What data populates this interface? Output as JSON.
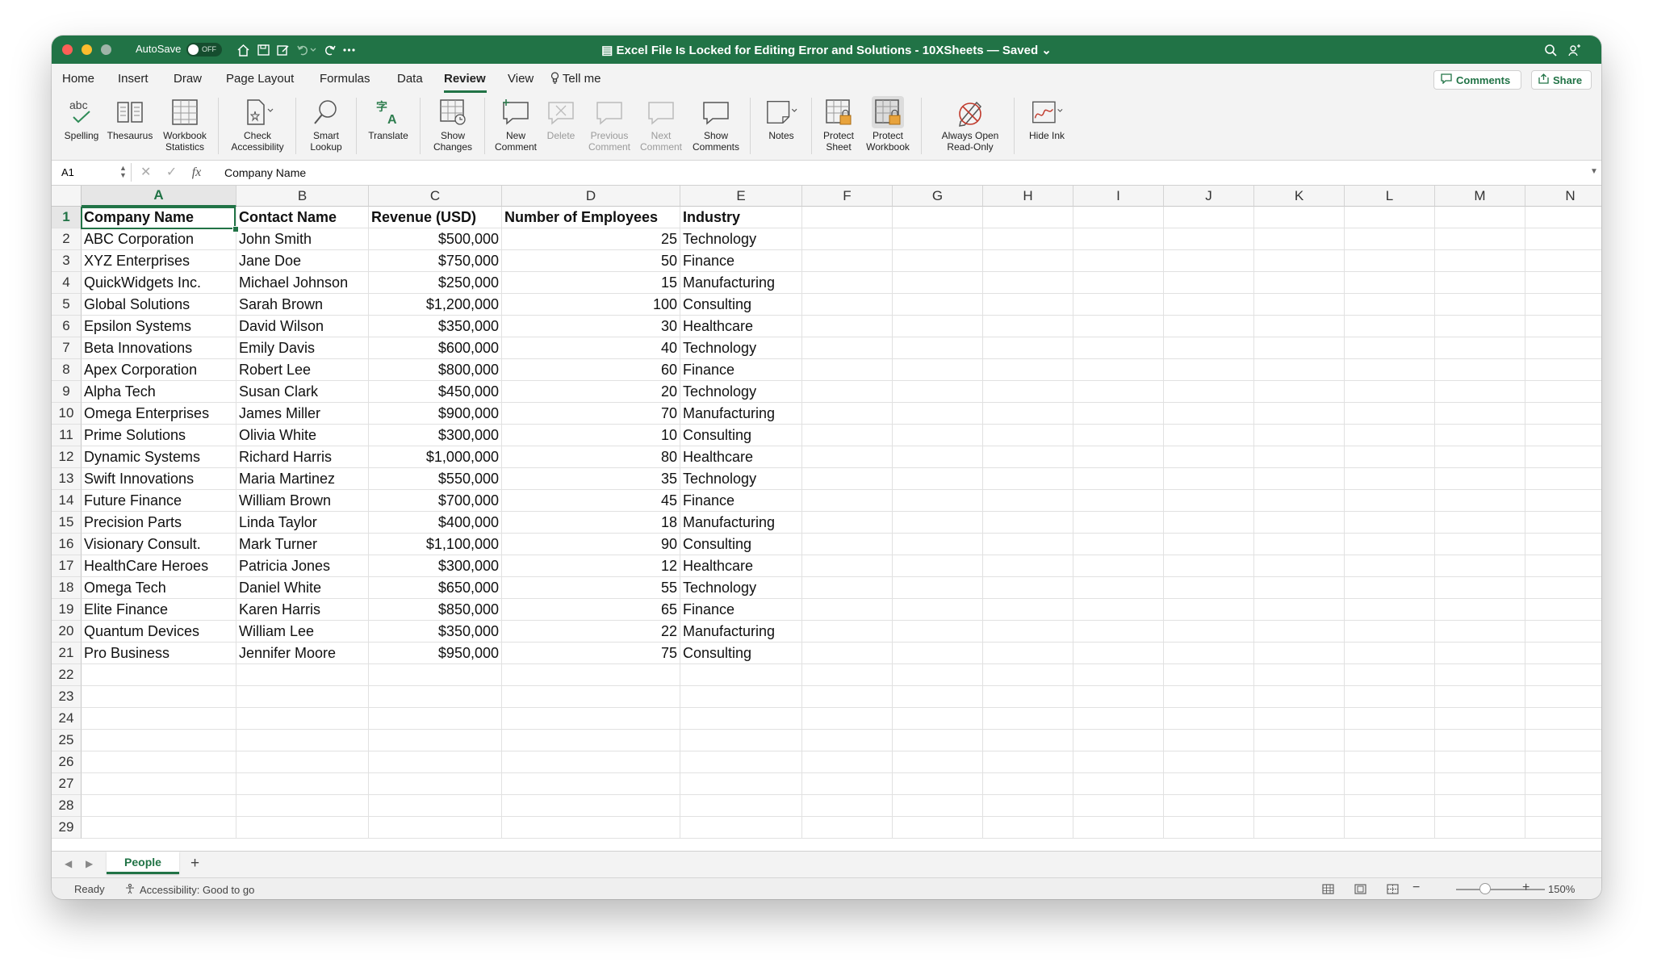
{
  "titlebar": {
    "autosave_label": "AutoSave",
    "autosave_state": "OFF",
    "doc_title": "Excel File Is Locked for Editing Error and Solutions - 10XSheets — Saved",
    "icons": [
      "home-icon",
      "save-icon",
      "edit-icon",
      "undo-icon",
      "redo-icon",
      "more-icon",
      "search-icon",
      "share-people-icon"
    ]
  },
  "menu": {
    "tabs": [
      "Home",
      "Insert",
      "Draw",
      "Page Layout",
      "Formulas",
      "Data",
      "Review",
      "View"
    ],
    "active_tab": "Review",
    "tell_me": "Tell me",
    "comments_label": "Comments",
    "share_label": "Share"
  },
  "ribbon": [
    {
      "label": "Spelling",
      "icon": "spelling-icon"
    },
    {
      "label": "Thesaurus",
      "icon": "thesaurus-icon"
    },
    {
      "label": "Workbook\nStatistics",
      "icon": "statistics-icon"
    },
    {
      "label": "Check\nAccessibility",
      "icon": "accessibility-icon"
    },
    {
      "label": "Smart\nLookup",
      "icon": "smart-lookup-icon"
    },
    {
      "label": "Translate",
      "icon": "translate-icon"
    },
    {
      "label": "Show\nChanges",
      "icon": "show-changes-icon"
    },
    {
      "label": "New\nComment",
      "icon": "new-comment-icon"
    },
    {
      "label": "Delete",
      "icon": "delete-comment-icon",
      "disabled": true
    },
    {
      "label": "Previous\nComment",
      "icon": "previous-comment-icon",
      "disabled": true
    },
    {
      "label": "Next\nComment",
      "icon": "next-comment-icon",
      "disabled": true
    },
    {
      "label": "Show\nComments",
      "icon": "show-comments-icon"
    },
    {
      "label": "Notes",
      "icon": "notes-icon"
    },
    {
      "label": "Protect\nSheet",
      "icon": "protect-sheet-icon"
    },
    {
      "label": "Protect\nWorkbook",
      "icon": "protect-workbook-icon",
      "selected": true
    },
    {
      "label": "Always Open\nRead-Only",
      "icon": "read-only-icon"
    },
    {
      "label": "Hide Ink",
      "icon": "hide-ink-icon"
    }
  ],
  "formula_bar": {
    "name_box": "A1",
    "fx_label": "fx",
    "content": "Company Name"
  },
  "grid": {
    "columns": [
      "A",
      "B",
      "C",
      "D",
      "E",
      "F",
      "G",
      "H",
      "I",
      "J",
      "K",
      "L",
      "M",
      "N"
    ],
    "row_numbers": [
      "1",
      "2",
      "3",
      "4",
      "5",
      "6",
      "7",
      "8",
      "9",
      "10",
      "11",
      "12",
      "13",
      "14",
      "15",
      "16",
      "17",
      "18",
      "19",
      "20",
      "21",
      "22",
      "23",
      "24",
      "25",
      "26",
      "27",
      "28",
      "29"
    ],
    "headers": [
      "Company Name",
      "Contact Name",
      "Revenue (USD)",
      "Number of Employees",
      "Industry"
    ],
    "rows": [
      [
        "ABC Corporation",
        "John Smith",
        "$500,000",
        "25",
        "Technology"
      ],
      [
        "XYZ Enterprises",
        "Jane Doe",
        "$750,000",
        "50",
        "Finance"
      ],
      [
        "QuickWidgets Inc.",
        "Michael Johnson",
        "$250,000",
        "15",
        "Manufacturing"
      ],
      [
        "Global Solutions",
        "Sarah Brown",
        "$1,200,000",
        "100",
        "Consulting"
      ],
      [
        "Epsilon Systems",
        "David Wilson",
        "$350,000",
        "30",
        "Healthcare"
      ],
      [
        "Beta Innovations",
        "Emily Davis",
        "$600,000",
        "40",
        "Technology"
      ],
      [
        "Apex Corporation",
        "Robert Lee",
        "$800,000",
        "60",
        "Finance"
      ],
      [
        "Alpha Tech",
        "Susan Clark",
        "$450,000",
        "20",
        "Technology"
      ],
      [
        "Omega Enterprises",
        "James Miller",
        "$900,000",
        "70",
        "Manufacturing"
      ],
      [
        "Prime Solutions",
        "Olivia White",
        "$300,000",
        "10",
        "Consulting"
      ],
      [
        "Dynamic Systems",
        "Richard Harris",
        "$1,000,000",
        "80",
        "Healthcare"
      ],
      [
        "Swift Innovations",
        "Maria Martinez",
        "$550,000",
        "35",
        "Technology"
      ],
      [
        "Future Finance",
        "William Brown",
        "$700,000",
        "45",
        "Finance"
      ],
      [
        "Precision Parts",
        "Linda Taylor",
        "$400,000",
        "18",
        "Manufacturing"
      ],
      [
        "Visionary Consult.",
        "Mark Turner",
        "$1,100,000",
        "90",
        "Consulting"
      ],
      [
        "HealthCare Heroes",
        "Patricia Jones",
        "$300,000",
        "12",
        "Healthcare"
      ],
      [
        "Omega Tech",
        "Daniel White",
        "$650,000",
        "55",
        "Technology"
      ],
      [
        "Elite Finance",
        "Karen Harris",
        "$850,000",
        "65",
        "Finance"
      ],
      [
        "Quantum Devices",
        "William Lee",
        "$350,000",
        "22",
        "Manufacturing"
      ],
      [
        "Pro Business",
        "Jennifer Moore",
        "$950,000",
        "75",
        "Consulting"
      ]
    ]
  },
  "sheets": {
    "tabs": [
      "People"
    ],
    "add_label": "+"
  },
  "status": {
    "ready": "Ready",
    "accessibility": "Accessibility: Good to go",
    "zoom": "150%",
    "zoom_value": 150
  }
}
